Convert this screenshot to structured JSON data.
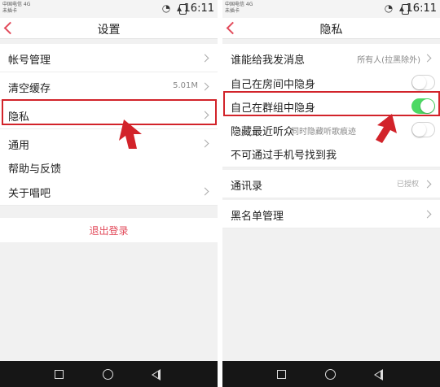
{
  "colors": {
    "accent": "#e24a5a",
    "highlight": "#d2232a",
    "toggle_on": "#4cd964",
    "background": "#f1f1f1"
  },
  "status_bar": {
    "carrier_line1": "中国电信 4G",
    "carrier_line2": "未插卡",
    "time": "16:11"
  },
  "left_screen": {
    "title": "设置",
    "rows": [
      {
        "label": "帐号管理"
      },
      {
        "label": "清空缓存",
        "value": "5.01M"
      },
      {
        "label": "隐私"
      },
      {
        "label": "通用"
      },
      {
        "label": "帮助与反馈"
      },
      {
        "label": "关于唱吧"
      }
    ],
    "logout_label": "退出登录"
  },
  "right_screen": {
    "title": "隐私",
    "rows": [
      {
        "label": "谁能给我发消息",
        "value": "所有人(拉黑除外)"
      },
      {
        "label": "自己在房间中隐身",
        "toggle": "off"
      },
      {
        "label": "自己在群组中隐身",
        "toggle": "on"
      },
      {
        "label": "隐藏最近听众",
        "sub": "同时隐藏听歌痕迹",
        "toggle": "off"
      },
      {
        "label": "不可通过手机号找到我"
      },
      {
        "label": "通讯录",
        "value": "已授权"
      },
      {
        "label": "黑名单管理"
      }
    ]
  },
  "icons": [
    "back-icon",
    "chevron-icon",
    "toggle-switch",
    "nav-square-icon",
    "nav-circle-icon",
    "nav-back-icon",
    "red-arrow-annotation"
  ]
}
